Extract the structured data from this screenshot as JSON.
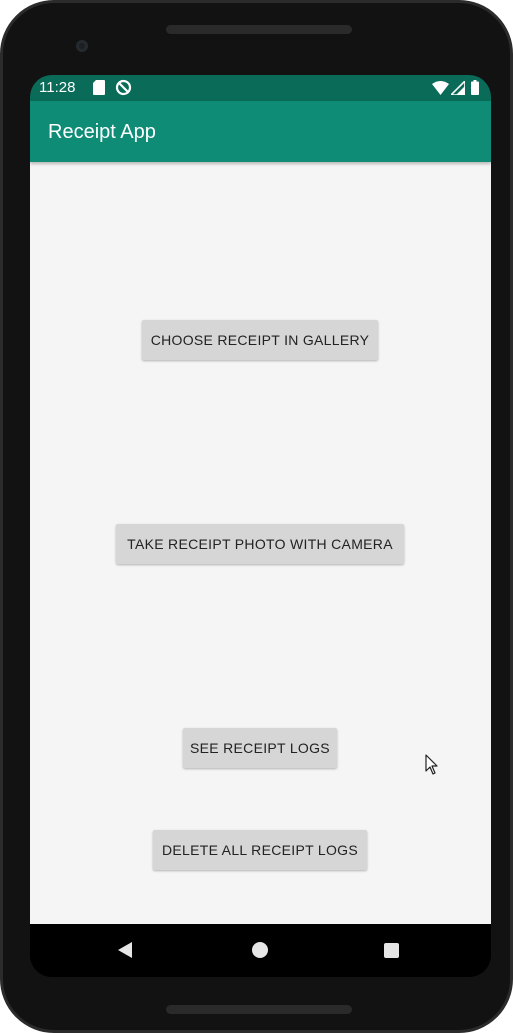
{
  "status_bar": {
    "time": "11:28",
    "left_icons": [
      "sd-card-icon",
      "no-sync-icon"
    ],
    "right_icons": [
      "wifi-icon",
      "cell-signal-icon",
      "battery-icon"
    ],
    "color": "#0a6b58"
  },
  "app_bar": {
    "title": "Receipt App",
    "color": "#0e8c76"
  },
  "buttons": {
    "choose_gallery": "CHOOSE RECEIPT IN GALLERY",
    "take_photo": "TAKE RECEIPT PHOTO WITH CAMERA",
    "see_logs": "SEE RECEIPT LOGS",
    "delete_logs": "DELETE ALL RECEIPT LOGS"
  },
  "nav_bar": {
    "icons": [
      "back-icon",
      "home-icon",
      "recents-icon"
    ]
  }
}
